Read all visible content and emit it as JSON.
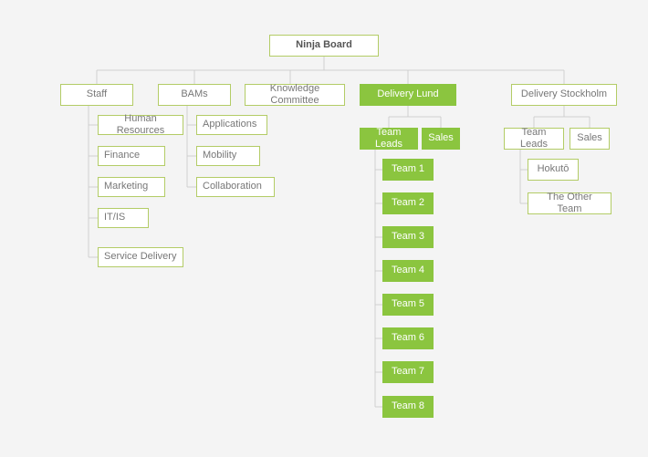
{
  "root": "Ninja Board",
  "level1": {
    "staff": "Staff",
    "bams": "BAMs",
    "knowledge": "Knowledge Committee",
    "delivery_lund": "Delivery Lund",
    "delivery_sthlm": "Delivery Stockholm"
  },
  "staff_children": [
    "Human Resources",
    "Finance",
    "Marketing",
    "IT/IS",
    "Service Delivery"
  ],
  "bams_children": [
    "Applications",
    "Mobility",
    "Collaboration"
  ],
  "lund": {
    "team_leads": "Team Leads",
    "sales": "Sales",
    "teams": [
      "Team 1",
      "Team 2",
      "Team 3",
      "Team 4",
      "Team 5",
      "Team 6",
      "Team 7",
      "Team 8"
    ]
  },
  "sthlm": {
    "team_leads": "Team Leads",
    "sales": "Sales",
    "hokuto": "Hokutō",
    "other": "The Other Team"
  },
  "colors": {
    "accent": "#8bc53f",
    "node_border": "#b3cc66",
    "page_bg": "#f4f4f4"
  }
}
